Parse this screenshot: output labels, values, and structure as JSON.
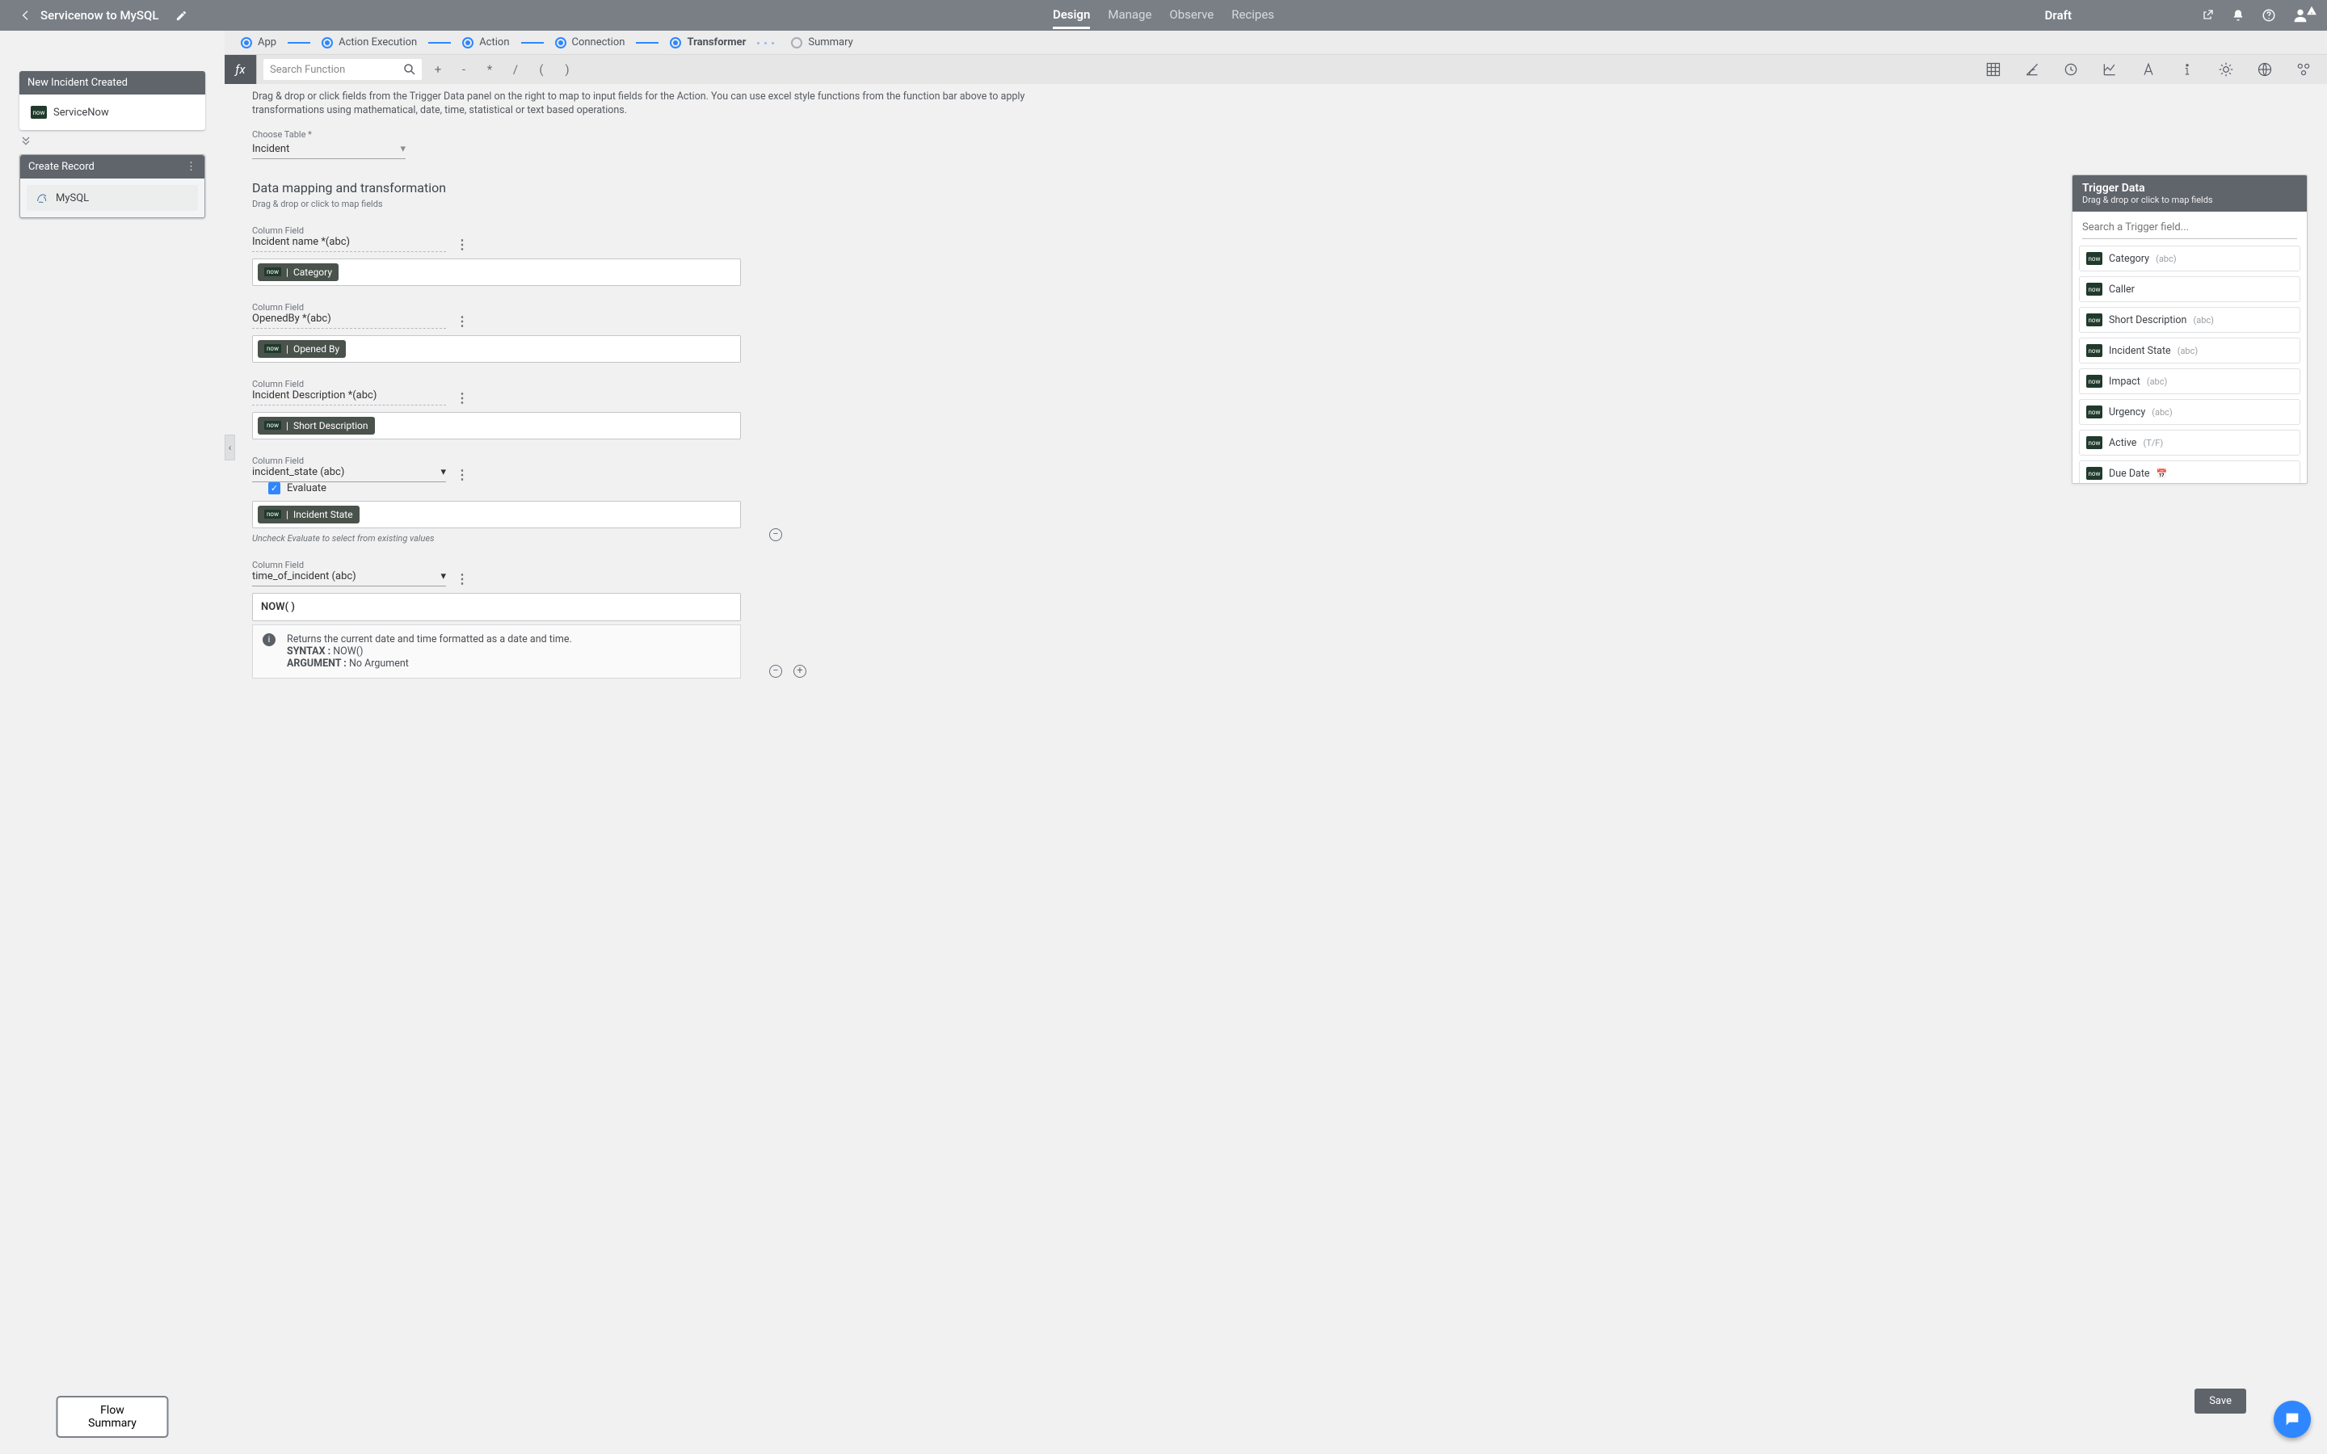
{
  "header": {
    "title": "Servicenow to MySQL",
    "tabs": [
      "Design",
      "Manage",
      "Observe",
      "Recipes"
    ],
    "active_tab": "Design",
    "status": "Draft"
  },
  "steps": [
    {
      "label": "App",
      "done": true
    },
    {
      "label": "Action Execution",
      "done": true
    },
    {
      "label": "Action",
      "done": true
    },
    {
      "label": "Connection",
      "done": true
    },
    {
      "label": "Transformer",
      "done": true,
      "current": true
    },
    {
      "label": "Summary",
      "done": false
    }
  ],
  "left": {
    "card1_title": "New Incident Created",
    "card1_app": "ServiceNow",
    "card2_title": "Create Record",
    "card2_app": "MySQL",
    "flow_summary": "Flow Summary"
  },
  "funcbar": {
    "search_placeholder": "Search Function",
    "ops": [
      "+",
      "-",
      "*",
      "/",
      "(",
      ")"
    ]
  },
  "help": "Drag & drop or click fields from the Trigger Data panel on the right to map to input fields for the Action. You can use excel style functions from the function bar above to apply transformations using mathematical, date, time, statistical or text based operations.",
  "form": {
    "choose_table_label": "Choose Table *",
    "choose_table_value": "Incident",
    "section_title": "Data mapping and transformation",
    "section_sub": "Drag & drop or click to map fields",
    "fields": [
      {
        "col_label": "Column Field",
        "col_value": "Incident name *(abc)",
        "chip": "Category",
        "kind": "dashed"
      },
      {
        "col_label": "Column Field",
        "col_value": "OpenedBy *(abc)",
        "chip": "Opened By",
        "kind": "dashed"
      },
      {
        "col_label": "Column Field",
        "col_value": "Incident Description *(abc)",
        "chip": "Short Description",
        "kind": "dashed"
      },
      {
        "col_label": "Column Field",
        "col_value": "incident_state (abc)",
        "chip": "Incident State",
        "kind": "select",
        "evaluate": true,
        "evaluate_label": "Evaluate",
        "uncheck_note": "Uncheck Evaluate to select from existing values"
      },
      {
        "col_label": "Column Field",
        "col_value": "time_of_incident (abc)",
        "formula": "NOW( )",
        "kind": "select",
        "func_desc": "Returns the current date and time formatted as a date and time.",
        "func_syntax_label": "SYNTAX :",
        "func_syntax": "NOW()",
        "func_arg_label": "ARGUMENT :",
        "func_arg": "No Argument"
      }
    ]
  },
  "right": {
    "title": "Trigger Data",
    "sub": "Drag & drop or click to map fields",
    "search_placeholder": "Search a Trigger field...",
    "items": [
      {
        "name": "Category",
        "type": "(abc)"
      },
      {
        "name": "Caller",
        "type": ""
      },
      {
        "name": "Short Description",
        "type": "(abc)"
      },
      {
        "name": "Incident State",
        "type": "(abc)"
      },
      {
        "name": "Impact",
        "type": "(abc)"
      },
      {
        "name": "Urgency",
        "type": "(abc)"
      },
      {
        "name": "Active",
        "type": "(T/F)"
      },
      {
        "name": "Due Date",
        "type": "📅"
      }
    ]
  },
  "save": "Save"
}
